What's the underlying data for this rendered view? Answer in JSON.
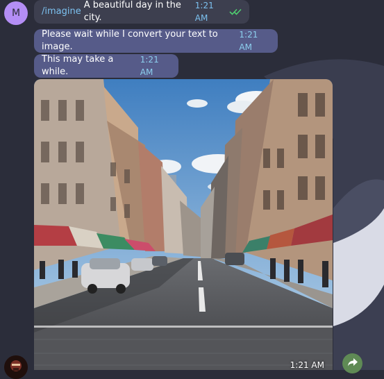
{
  "chat": {
    "user_avatar_initial": "M",
    "messages": [
      {
        "command": "/imagine",
        "text": "A beautiful day in the city.",
        "time": "1:21 AM",
        "status": "read"
      },
      {
        "text": "Please wait while I convert your text to image.",
        "time": "1:21 AM"
      },
      {
        "text": "This may take a while.",
        "time": "1:21 AM"
      }
    ],
    "image_message": {
      "time": "1:21 AM"
    }
  },
  "icons": {
    "read_status": "double-check-icon",
    "share": "share-arrow-icon"
  },
  "colors": {
    "background": "#2b2d3a",
    "outgoing_bubble": "#3d3f4f",
    "incoming_bubble": "#565b89",
    "accent": "#7cc1f0",
    "read_check": "#4fcf70",
    "share_button": "#5f8a55",
    "avatar": "#b48ef5"
  }
}
